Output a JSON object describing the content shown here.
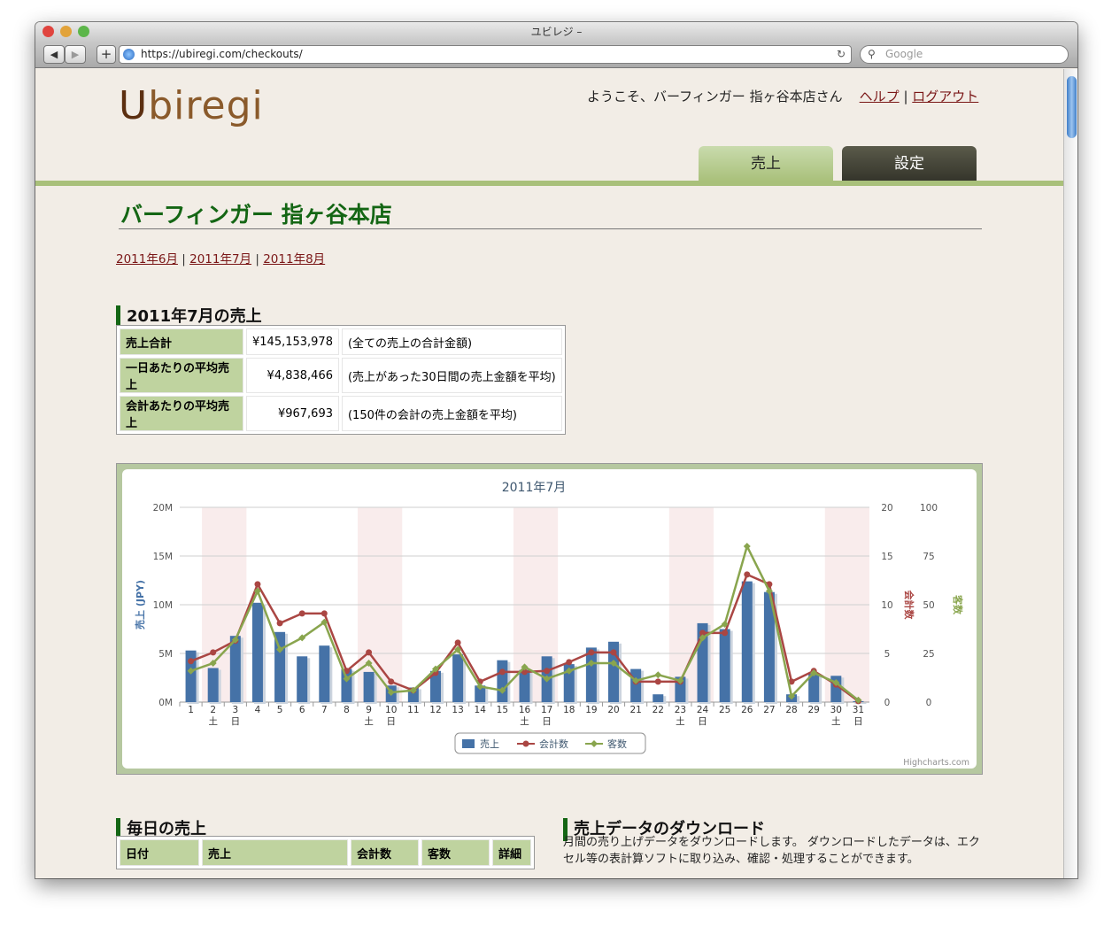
{
  "window": {
    "title": "ユビレジ –",
    "url": "https://ubiregi.com/checkouts/",
    "search_placeholder": "Google"
  },
  "header": {
    "logo_u": "U",
    "logo_rest": "biregi",
    "welcome": "ようこそ、バーフィンガー 指ヶ谷本店さん",
    "help": "ヘルプ",
    "separator": "|",
    "logout": "ログアウト"
  },
  "tabs": [
    {
      "label": "売上",
      "active": true
    },
    {
      "label": "設定",
      "active": false
    }
  ],
  "store_title": "バーフィンガー 指ヶ谷本店",
  "months": [
    "2011年6月",
    "2011年7月",
    "2011年8月"
  ],
  "month_sep": "|",
  "summary": {
    "heading": "2011年7月の売上",
    "rows": [
      {
        "label": "売上合計",
        "value": "¥145,153,978",
        "note": "(全ての売上の合計金額)"
      },
      {
        "label": "一日あたりの平均売上",
        "value": "¥4,838,466",
        "note": "(売上があった30日間の売上金額を平均)"
      },
      {
        "label": "会計あたりの平均売上",
        "value": "¥967,693",
        "note": "(150件の会計の売上金額を平均)"
      }
    ]
  },
  "daily": {
    "heading": "毎日の売上",
    "columns": [
      "日付",
      "売上",
      "会計数",
      "客数",
      "詳細"
    ]
  },
  "download": {
    "heading": "売上データのダウンロード",
    "text": "月間の売り上げデータをダウンロードします。 ダウンロードしたデータは、エクセル等の表計算ソフトに取り込み、確認・処理することができます。"
  },
  "chart_data": {
    "type": "bar",
    "title": "2011年7月",
    "credit": "Highcharts.com",
    "categories": [
      "1",
      "2",
      "3",
      "4",
      "5",
      "6",
      "7",
      "8",
      "9",
      "10",
      "11",
      "12",
      "13",
      "14",
      "15",
      "16",
      "17",
      "18",
      "19",
      "20",
      "21",
      "22",
      "23",
      "24",
      "25",
      "26",
      "27",
      "28",
      "29",
      "30",
      "31"
    ],
    "weekday_labels": [
      "",
      "土",
      "日",
      "",
      "",
      "",
      "",
      "",
      "土",
      "日",
      "",
      "",
      "",
      "",
      "",
      "土",
      "日",
      "",
      "",
      "",
      "",
      "",
      "土",
      "日",
      "",
      "",
      "",
      "",
      "",
      "土",
      "日"
    ],
    "weekend_bands": [
      [
        2,
        3
      ],
      [
        9,
        10
      ],
      [
        16,
        17
      ],
      [
        23,
        24
      ],
      [
        30,
        31
      ]
    ],
    "y_left": {
      "label": "売上 (JPY)",
      "ticks": [
        "0M",
        "5M",
        "10M",
        "15M",
        "20M"
      ],
      "range": [
        0,
        20000000
      ]
    },
    "y_right1": {
      "label": "会計数",
      "ticks": [
        "0",
        "5",
        "10",
        "15",
        "20"
      ],
      "range": [
        0,
        20
      ]
    },
    "y_right2": {
      "label": "客数",
      "ticks": [
        "0",
        "25",
        "50",
        "75",
        "100"
      ],
      "range": [
        0,
        100
      ]
    },
    "colors": {
      "sales": "#4572A7",
      "checkouts": "#AA4643",
      "customers": "#89A54E",
      "band": "#f9ecec"
    },
    "series": [
      {
        "name": "売上",
        "axis": "y_left",
        "values": [
          5300000,
          3500000,
          6800000,
          10200000,
          7200000,
          4700000,
          5800000,
          3400000,
          3100000,
          1700000,
          1500000,
          3200000,
          4900000,
          1700000,
          4300000,
          3300000,
          4700000,
          3900000,
          5600000,
          6200000,
          3400000,
          800000,
          2600000,
          8100000,
          7500000,
          12400000,
          11300000,
          800000,
          2900000,
          2700000,
          100000
        ]
      },
      {
        "name": "会計数",
        "axis": "y_right1",
        "values": [
          4.2,
          5.1,
          6.3,
          12.1,
          8.1,
          9.1,
          9.1,
          3.2,
          5.1,
          2.1,
          1.2,
          3.0,
          6.1,
          2.1,
          3.1,
          3.1,
          3.2,
          4.1,
          5.1,
          5.1,
          2.1,
          2.1,
          2.1,
          7.1,
          7.1,
          13.1,
          12.1,
          2.1,
          3.2,
          1.8,
          0.1
        ]
      },
      {
        "name": "客数",
        "axis": "y_right2",
        "values": [
          16,
          20,
          32,
          57,
          27,
          33,
          41,
          12,
          20,
          5,
          6,
          17,
          27,
          8,
          6,
          18,
          12,
          16,
          20,
          20,
          11,
          14,
          11,
          33,
          40,
          80,
          57,
          3,
          15,
          10,
          1
        ]
      }
    ],
    "legend": "bottom-center"
  }
}
